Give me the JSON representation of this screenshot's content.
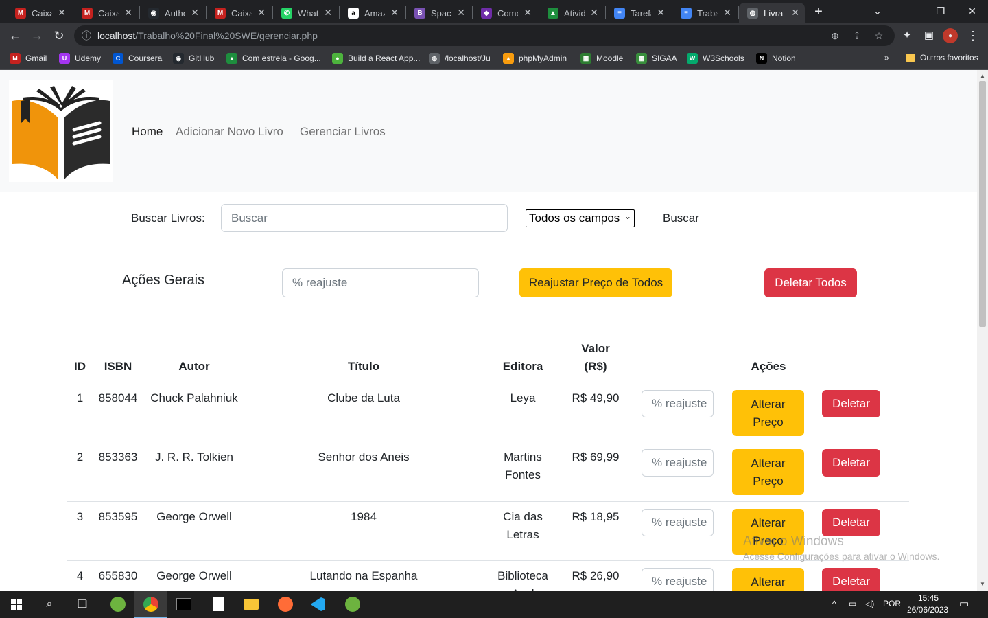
{
  "browser": {
    "tabs": [
      {
        "title": "Caixa de entrada",
        "icon": "gmail-icon",
        "color": "#c5221f",
        "glyph": "M"
      },
      {
        "title": "Caixa de entrada",
        "icon": "gmail-100-icon",
        "color": "#c5221f",
        "glyph": "M"
      },
      {
        "title": "Authorization",
        "icon": "github-icon",
        "color": "#24292f",
        "glyph": "◉"
      },
      {
        "title": "Caixa de entrada",
        "icon": "gmail-icon",
        "color": "#c5221f",
        "glyph": "M"
      },
      {
        "title": "WhatsApp",
        "icon": "whatsapp-icon",
        "color": "#25d366",
        "glyph": "✆"
      },
      {
        "title": "Amazon",
        "icon": "amazon-icon",
        "color": "#ffffff",
        "glyph": "a"
      },
      {
        "title": "Spacing",
        "icon": "bootstrap-icon",
        "color": "#7952b3",
        "glyph": "B"
      },
      {
        "title": "Como",
        "icon": "sigaa-icon",
        "color": "#6f2da8",
        "glyph": "◆"
      },
      {
        "title": "Atividades",
        "icon": "google-drive-icon",
        "color": "#1e8e3e",
        "glyph": "▲"
      },
      {
        "title": "Tarefa",
        "icon": "google-docs-icon",
        "color": "#4285f4",
        "glyph": "≡"
      },
      {
        "title": "Trabalho",
        "icon": "google-docs-icon",
        "color": "#4285f4",
        "glyph": "≡"
      },
      {
        "title": "Livraria",
        "icon": "globe-icon",
        "color": "#5f6368",
        "glyph": "◍"
      }
    ],
    "url_host": "localhost",
    "url_path": "/Trabalho%20Final%20SWE/gerenciar.php",
    "bookmarks": [
      {
        "label": "Gmail",
        "icon": "gmail-icon",
        "color": "#c5221f",
        "glyph": "M"
      },
      {
        "label": "Udemy",
        "icon": "udemy-icon",
        "color": "#a435f0",
        "glyph": "U"
      },
      {
        "label": "Coursera",
        "icon": "coursera-icon",
        "color": "#0056d2",
        "glyph": "C"
      },
      {
        "label": "GitHub",
        "icon": "github-icon",
        "color": "#24292f",
        "glyph": "◉"
      },
      {
        "label": "Com estrela - Goog...",
        "icon": "google-drive-icon",
        "color": "#1e8e3e",
        "glyph": "▲"
      },
      {
        "label": "Build a React App...",
        "icon": "leaf-icon",
        "color": "#4db33d",
        "glyph": "●"
      },
      {
        "label": "/localhost/Ju",
        "icon": "globe-icon",
        "color": "#5f6368",
        "glyph": "◍"
      },
      {
        "label": "phpMyAdmin",
        "icon": "phpmyadmin-icon",
        "color": "#f89c0e",
        "glyph": "▲"
      },
      {
        "label": "Moodle",
        "icon": "moodle-icon",
        "color": "#2e7d32",
        "glyph": "▦"
      },
      {
        "label": "SIGAA",
        "icon": "sigaa-icon",
        "color": "#388e3c",
        "glyph": "▦"
      },
      {
        "label": "W3Schools",
        "icon": "w3schools-icon",
        "color": "#04aa6d",
        "glyph": "W"
      },
      {
        "label": "Notion",
        "icon": "notion-icon",
        "color": "#000000",
        "glyph": "N"
      }
    ],
    "more_bookmarks": "»",
    "other_favorites": "Outros favoritos"
  },
  "navbar": {
    "links": [
      "Home",
      "Adicionar Novo Livro",
      "Gerenciar Livros"
    ]
  },
  "search": {
    "label": "Buscar Livros:",
    "placeholder": "Buscar",
    "select_value": "Todos os campos",
    "button": "Buscar"
  },
  "general_actions": {
    "title": "Ações Gerais",
    "placeholder": "% reajuste",
    "adjust_all": "Reajustar Preço de Todos",
    "delete_all": "Deletar Todos"
  },
  "table": {
    "headers": {
      "id": "ID",
      "isbn": "ISBN",
      "autor": "Autor",
      "titulo": "Título",
      "editora": "Editora",
      "valor_1": "Valor",
      "valor_2": "(R$)",
      "acoes": "Ações"
    },
    "input_placeholder": "% reajuste",
    "alter_1": "Alterar",
    "alter_2": "Preço",
    "delete": "Deletar",
    "rows": [
      {
        "id": "1",
        "isbn": "858044",
        "autor": "Chuck Palahniuk",
        "titulo": "Clube da Luta",
        "editora_1": "Leya",
        "editora_2": "",
        "valor": "R$ 49,90"
      },
      {
        "id": "2",
        "isbn": "853363",
        "autor": "J. R. R. Tolkien",
        "titulo": "Senhor dos Aneis",
        "editora_1": "Martins",
        "editora_2": "Fontes",
        "valor": "R$ 69,99"
      },
      {
        "id": "3",
        "isbn": "853595",
        "autor": "George Orwell",
        "titulo": "1984",
        "editora_1": "Cia das",
        "editora_2": "Letras",
        "valor": "R$ 18,95"
      },
      {
        "id": "4",
        "isbn": "655830",
        "autor": "George Orwell",
        "titulo": "Lutando na Espanha",
        "editora_1": "Biblioteca",
        "editora_2": "Azul",
        "valor": "R$ 26,90"
      }
    ]
  },
  "watermark": {
    "line1": "Ativar o Windows",
    "line2": "Acesse Configurações para ativar o Windows."
  },
  "taskbar": {
    "language": "POR",
    "time": "15:45",
    "date": "26/06/2023"
  },
  "colors": {
    "warning": "#ffc107",
    "danger": "#dc3545",
    "navbar_bg": "#f8f9fa"
  }
}
